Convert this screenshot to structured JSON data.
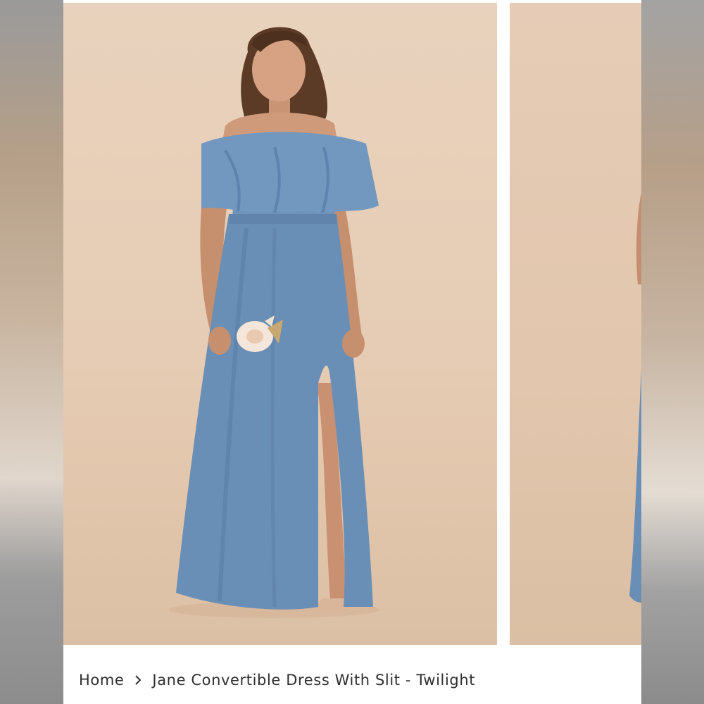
{
  "breadcrumb": {
    "home_label": "Home",
    "separator_icon": "chevron-right-icon",
    "current_label": "Jane Convertible Dress With Slit - Twilight"
  },
  "gallery": {
    "images": [
      {
        "name": "product-photo-front",
        "alt": "Model in twilight blue off-shoulder convertible maxi dress with slit holding a bouquet"
      },
      {
        "name": "product-photo-next",
        "alt": "Next product photo partially visible"
      }
    ]
  },
  "colors": {
    "dress": "#6a8fb6",
    "backdrop": "#e7cfb8",
    "text": "#2f2f2f"
  }
}
